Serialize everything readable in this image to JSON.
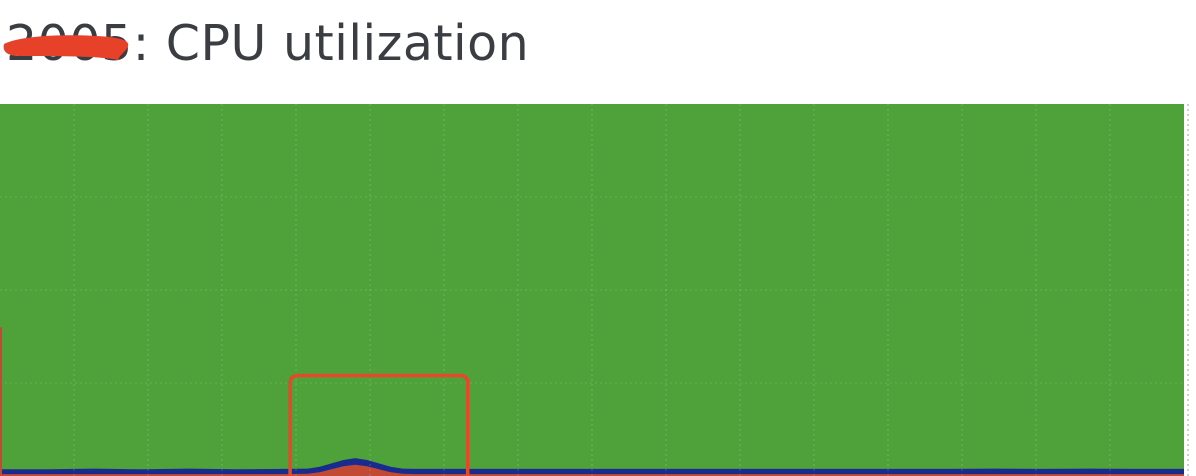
{
  "header": {
    "title": "2005: CPU utilization"
  },
  "chart_data": {
    "type": "area",
    "title": "2005: CPU utilization",
    "xlabel": "",
    "ylabel": "",
    "ylim": [
      0,
      100
    ],
    "stacked": true,
    "grid": true,
    "legend": "none",
    "x": [
      0,
      4,
      8,
      12,
      16,
      20,
      24,
      26,
      27,
      28,
      29,
      30,
      31,
      32,
      33,
      34,
      35,
      36,
      40,
      44,
      48,
      52,
      56,
      60,
      64,
      68,
      72,
      76,
      80,
      84,
      88,
      92,
      96,
      100
    ],
    "series": [
      {
        "color": "#c24a35",
        "values": [
          0.5,
          0.5,
          0.5,
          0.5,
          0.5,
          0.5,
          0.5,
          0.6,
          1.0,
          1.8,
          2.6,
          3.0,
          2.6,
          1.8,
          1.0,
          0.6,
          0.5,
          0.5,
          0.5,
          0.5,
          0.5,
          0.5,
          0.5,
          0.5,
          0.5,
          0.5,
          0.5,
          0.5,
          0.5,
          0.5,
          0.5,
          0.5,
          0.5,
          0.5
        ]
      },
      {
        "color": "#1a2b8f",
        "values": [
          1.3,
          1.3,
          1.5,
          1.3,
          1.5,
          1.3,
          1.4,
          1.4,
          1.5,
          1.6,
          1.7,
          1.8,
          1.7,
          1.6,
          1.5,
          1.4,
          1.4,
          1.4,
          1.4,
          1.4,
          1.4,
          1.4,
          1.4,
          1.4,
          1.4,
          1.4,
          1.4,
          1.4,
          1.4,
          1.5,
          1.4,
          1.5,
          1.4,
          1.4
        ]
      },
      {
        "color": "#4fa23a",
        "fill_to_top": true
      }
    ],
    "highlight_box": {
      "x_range": [
        24.5,
        39.5
      ],
      "y_top": 27,
      "color": "#e5482b"
    },
    "redaction_color": "#e8412a"
  }
}
